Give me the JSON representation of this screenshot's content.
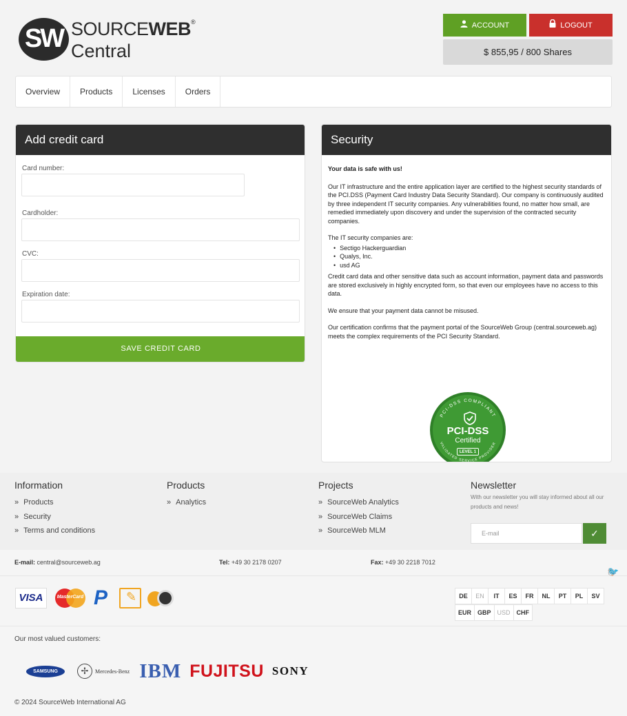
{
  "brand": {
    "logo_mark": "SW",
    "name_part1": "SOURCE",
    "name_part2": "WEB",
    "registered": "®",
    "subtitle": "Central"
  },
  "header": {
    "account_label": "ACCOUNT",
    "logout_label": "LOGOUT",
    "balance": "$ 855,95 / 800 Shares"
  },
  "nav": {
    "items": [
      {
        "label": "Overview"
      },
      {
        "label": "Products"
      },
      {
        "label": "Licenses"
      },
      {
        "label": "Orders"
      }
    ]
  },
  "card_form": {
    "title": "Add credit card",
    "fields": {
      "card_number": {
        "label": "Card number:",
        "value": ""
      },
      "cardholder": {
        "label": "Cardholder:",
        "value": ""
      },
      "cvc": {
        "label": "CVC:",
        "value": ""
      },
      "expiration": {
        "label": "Expiration date:",
        "value": ""
      }
    },
    "submit_label": "SAVE CREDIT CARD"
  },
  "security": {
    "title": "Security",
    "headline": "Your data is safe with us!",
    "para1": "Our IT infrastructure and the entire application layer are certified to the highest security standards of the PCI.DSS (Payment Card Industry Data Security Standard). Our company is continuously audited by three independent IT security companies. Any vulnerabilities found, no matter how small, are remedied immediately upon discovery and under the supervision of the contracted security companies.",
    "companies_intro": "The IT security companies are:",
    "companies": [
      "Sectigo Hackerguardian",
      "Qualys, Inc.",
      "usd AG"
    ],
    "para2": "Credit card data and other sensitive data such as account information, payment data and passwords are stored exclusively in highly encrypted form, so that even our employees have no access to this data.",
    "para3": "We ensure that your payment data cannot be misused.",
    "para4": "Our certification confirms that the payment portal of the SourceWeb Group (central.sourceweb.ag) meets the complex requirements of the PCI Security Standard.",
    "badge": {
      "ring_top": "PCI-DSS COMPLIANT",
      "ring_bottom": "VALIDATED SERVICE PROVIDER",
      "title": "PCI-DSS",
      "subtitle": "Certified",
      "level": "LEVEL 1",
      "color": "#3f9a34"
    }
  },
  "footer": {
    "information": {
      "title": "Information",
      "links": [
        "Products",
        "Security",
        "Terms and conditions"
      ]
    },
    "products": {
      "title": "Products",
      "links": [
        "Analytics"
      ]
    },
    "projects": {
      "title": "Projects",
      "links": [
        "SourceWeb Analytics",
        "SourceWeb Claims",
        "SourceWeb MLM"
      ]
    },
    "newsletter": {
      "title": "Newsletter",
      "text": "With our newsletter you will stay informed about all our products and news!",
      "placeholder": "E-mail"
    },
    "contact": {
      "email_label": "E-mail:",
      "email": "central@sourceweb.ag",
      "tel_label": "Tel:",
      "tel": "+49 30 2178 0207",
      "fax_label": "Fax:",
      "fax": "+49 30 2218 7012"
    },
    "payments": {
      "visa": "VISA",
      "mastercard": "MasterCard",
      "paypal": "P"
    },
    "languages": [
      "DE",
      "EN",
      "IT",
      "ES",
      "FR",
      "NL",
      "PT",
      "PL",
      "SV"
    ],
    "currencies": [
      "EUR",
      "GBP",
      "USD",
      "CHF"
    ],
    "customers_label": "Our most valued customers:",
    "customers": {
      "samsung": "SAMSUNG",
      "mercedes": "Mercedes-Benz",
      "ibm": "IBM",
      "fujitsu": "FUJITSU",
      "sony": "SONY"
    },
    "copyright": "© 2024 SourceWeb International AG"
  },
  "colors": {
    "green": "#6aab2c",
    "red": "#c9302c",
    "dark_header": "#2f2f2f"
  }
}
